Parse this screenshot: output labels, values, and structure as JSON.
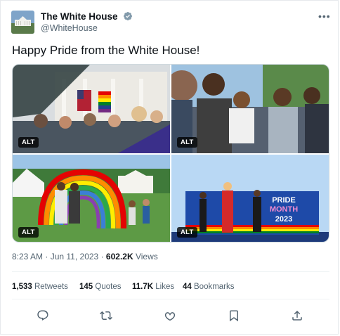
{
  "account": {
    "name": "The White House",
    "handle": "@WhiteHouse",
    "verified": true,
    "verified_color": "#829aab"
  },
  "tweet": {
    "text": "Happy Pride from the White House!",
    "time": "8:23 AM",
    "separator": "·",
    "date": "Jun 11, 2023",
    "views_count": "602.2K",
    "views_label": "Views"
  },
  "media": {
    "alt_badge": "ALT",
    "images": [
      {
        "icon": "crowd-photo"
      },
      {
        "icon": "crowd-photo"
      },
      {
        "icon": "balloon-arch-photo"
      },
      {
        "icon": "stage-photo"
      }
    ],
    "banner_text": [
      "PRIDE",
      "MONTH",
      "2023"
    ]
  },
  "stats": [
    {
      "count": "1,533",
      "label": "Retweets"
    },
    {
      "count": "145",
      "label": "Quotes"
    },
    {
      "count": "11.7K",
      "label": "Likes"
    },
    {
      "count": "44",
      "label": "Bookmarks"
    }
  ],
  "actions": [
    {
      "name": "reply",
      "icon": "reply-icon"
    },
    {
      "name": "retweet",
      "icon": "retweet-icon"
    },
    {
      "name": "like",
      "icon": "heart-icon"
    },
    {
      "name": "bookmark",
      "icon": "bookmark-icon"
    },
    {
      "name": "share",
      "icon": "share-icon"
    }
  ],
  "colors": {
    "text": "#0f1419",
    "secondary": "#536471",
    "border": "#cfd9de"
  }
}
